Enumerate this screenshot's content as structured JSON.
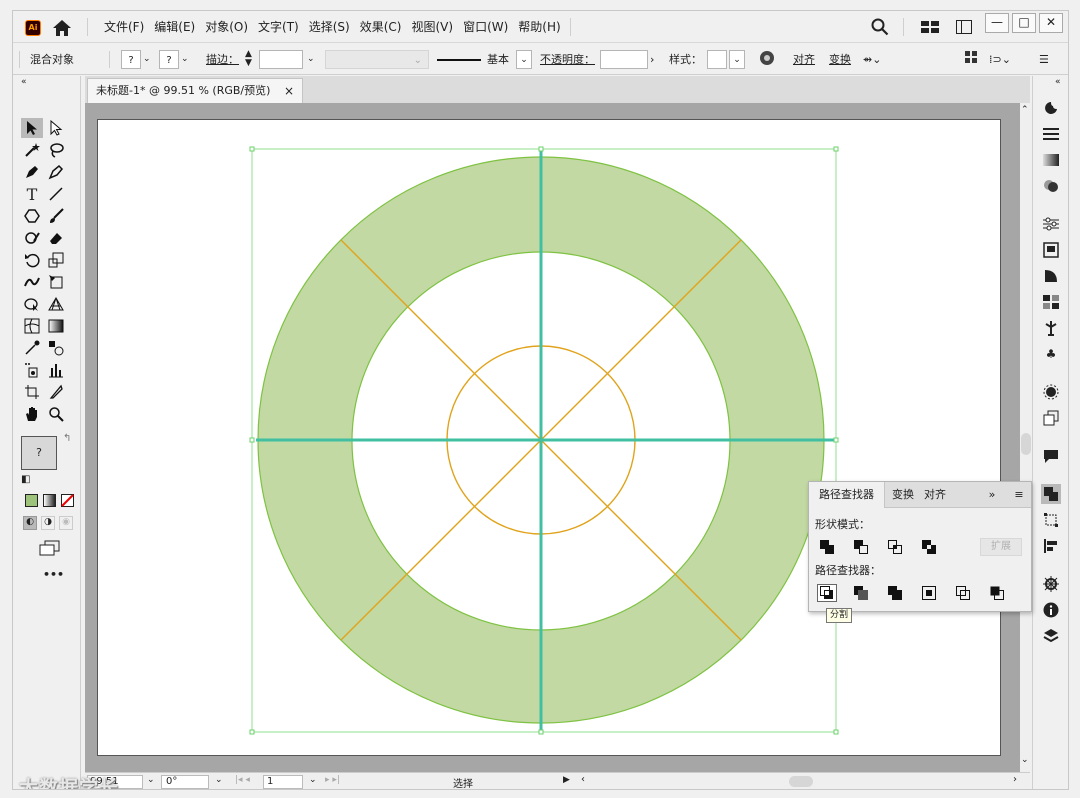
{
  "app": {
    "logo_text": "Ai",
    "home_icon": "home-icon"
  },
  "menu": [
    "文件(F)",
    "编辑(E)",
    "对象(O)",
    "文字(T)",
    "选择(S)",
    "效果(C)",
    "视图(V)",
    "窗口(W)",
    "帮助(H)"
  ],
  "window": {
    "minimize": "—",
    "restore": "□",
    "close": "✕"
  },
  "control_bar": {
    "mode_label": "混合对象",
    "fill_value": "?",
    "stroke_value": "?",
    "stroke_label": "描边：",
    "stroke_weight": "",
    "profile_label": "基本",
    "opacity_label": "不透明度：",
    "opacity_value": "",
    "style_label": "样式：",
    "align_label": "对齐",
    "transform_label": "变换"
  },
  "document_tab": {
    "title": "未标题-1* @ 99.51 % (RGB/预览)",
    "close": "×"
  },
  "toolbar": {
    "more": "•••",
    "fill_swatch": "?"
  },
  "status_bar": {
    "zoom": "99.51",
    "rotation": "0°",
    "artboard_number": "1",
    "tool_label": "选择"
  },
  "pathfinder_panel": {
    "tabs": [
      "路径查找器",
      "变换",
      "对齐"
    ],
    "overflow": "»",
    "shape_modes_label": "形状模式：",
    "pathfinders_label": "路径查找器：",
    "expand_button": "扩展",
    "tooltip": "分割"
  },
  "watermark": "大数据学长",
  "colors": {
    "ring_fill": "#c2d9a3",
    "ring_stroke": "#7ec242",
    "guide_orange": "#e0a31b",
    "axis_teal": "#40c0a0",
    "selection_green": "#8fe08f"
  }
}
